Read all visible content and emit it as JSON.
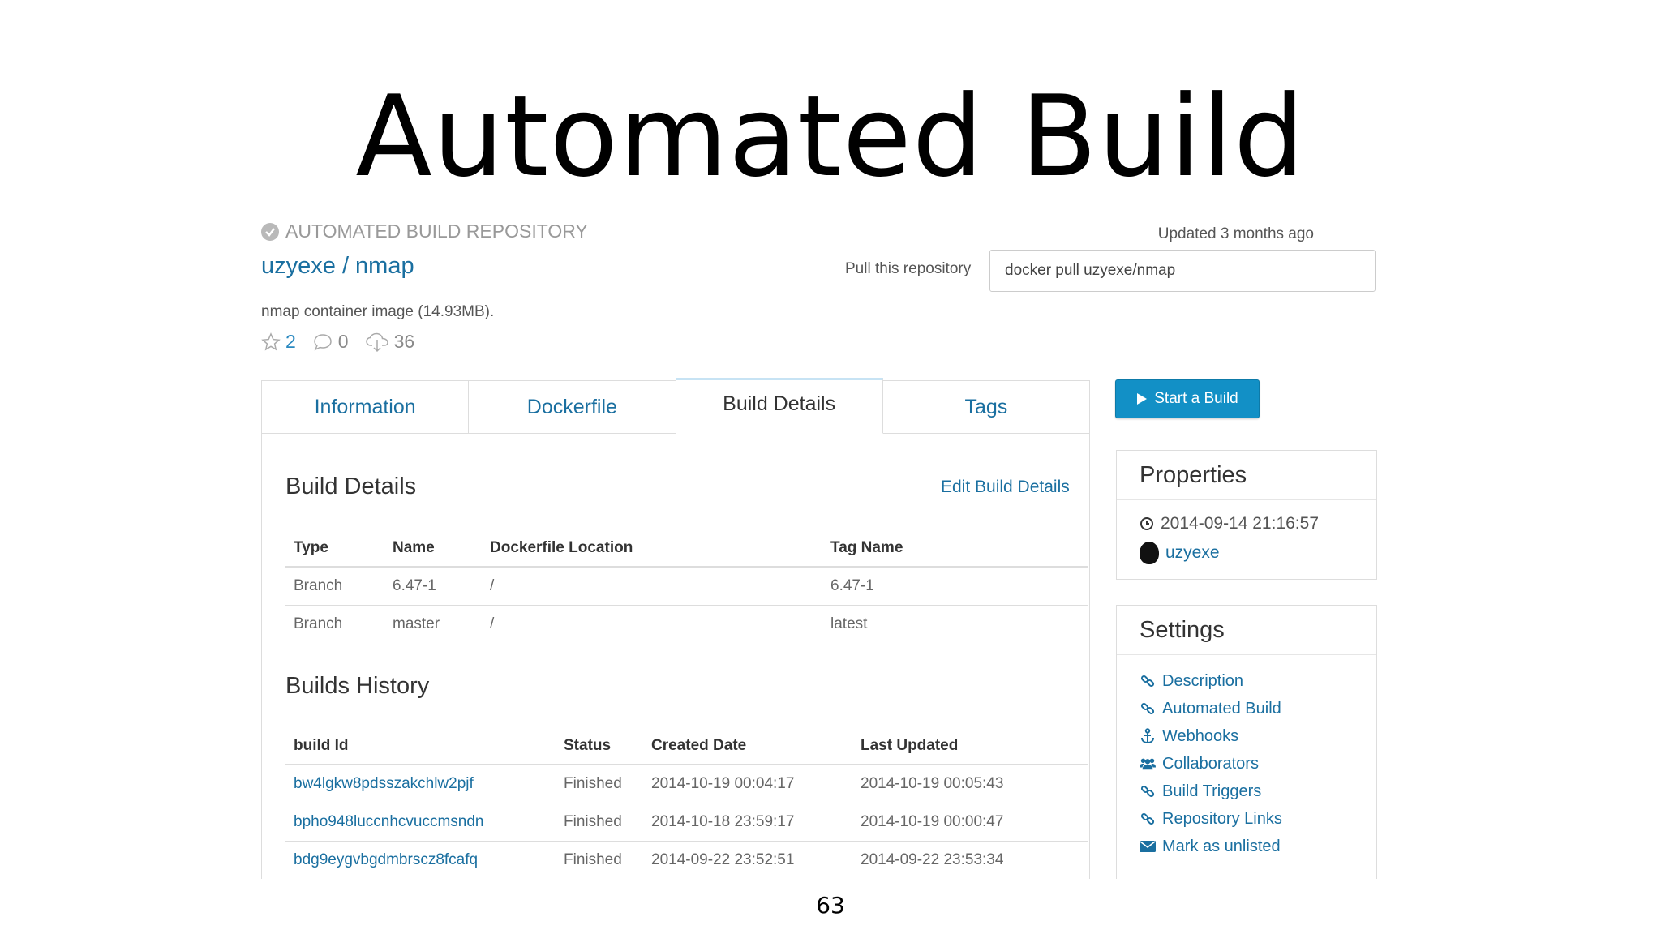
{
  "slide": {
    "title": "Automated Build",
    "page_number": "63"
  },
  "repo": {
    "kind": "AUTOMATED BUILD REPOSITORY",
    "name": "uzyexe / nmap",
    "description": "nmap container image (14.93MB).",
    "stars": "2",
    "comments": "0",
    "downloads": "36",
    "updated": "Updated 3 months ago",
    "pull_label": "Pull this repository",
    "pull_command": "docker pull uzyexe/nmap"
  },
  "tabs": [
    {
      "label": "Information"
    },
    {
      "label": "Dockerfile"
    },
    {
      "label": "Build Details"
    },
    {
      "label": "Tags"
    }
  ],
  "active_tab": "Build Details",
  "build_details": {
    "heading": "Build Details",
    "edit_link": "Edit Build Details",
    "columns": [
      "Type",
      "Name",
      "Dockerfile Location",
      "Tag Name"
    ],
    "rows": [
      [
        "Branch",
        "6.47-1",
        "/",
        "6.47-1"
      ],
      [
        "Branch",
        "master",
        "/",
        "latest"
      ]
    ]
  },
  "builds_history": {
    "heading": "Builds History",
    "columns": [
      "build Id",
      "Status",
      "Created Date",
      "Last Updated"
    ],
    "rows": [
      [
        "bw4lgkw8pdsszakchlw2pjf",
        "Finished",
        "2014-10-19 00:04:17",
        "2014-10-19 00:05:43"
      ],
      [
        "bpho948luccnhcvuccmsndn",
        "Finished",
        "2014-10-18 23:59:17",
        "2014-10-19 00:00:47"
      ],
      [
        "bdg9eygvbgdmbrscz8fcafq",
        "Finished",
        "2014-09-22 23:52:51",
        "2014-09-22 23:53:34"
      ]
    ]
  },
  "start_build_label": "Start a Build",
  "properties": {
    "heading": "Properties",
    "date": "2014-09-14 21:16:57",
    "owner": "uzyexe"
  },
  "settings": {
    "heading": "Settings",
    "items": [
      {
        "label": "Description",
        "icon": "link-icon"
      },
      {
        "label": "Automated Build",
        "icon": "link-icon"
      },
      {
        "label": "Webhooks",
        "icon": "anchor-icon"
      },
      {
        "label": "Collaborators",
        "icon": "users-icon"
      },
      {
        "label": "Build Triggers",
        "icon": "link-icon"
      },
      {
        "label": "Repository Links",
        "icon": "link-icon"
      },
      {
        "label": "Mark as unlisted",
        "icon": "envelope-icon"
      }
    ]
  },
  "colors": {
    "link": "#1a6fa0",
    "button": "#1290c6"
  }
}
